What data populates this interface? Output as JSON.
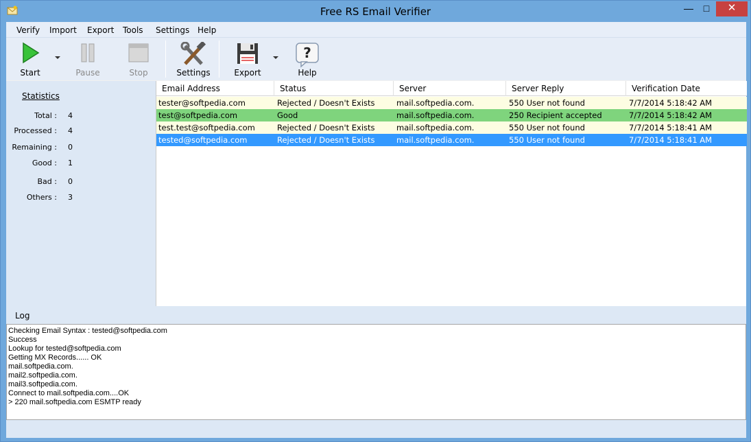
{
  "window": {
    "title": "Free RS Email Verifier",
    "minimize": "—",
    "maximize": "□",
    "close": "✕"
  },
  "menu": [
    "Verify",
    "Import",
    "Export",
    "Tools",
    "Settings",
    "Help"
  ],
  "toolbar": {
    "start": "Start",
    "pause": "Pause",
    "stop": "Stop",
    "settings": "Settings",
    "export": "Export",
    "help": "Help"
  },
  "statistics": {
    "title": "Statistics",
    "items": [
      {
        "label": "Total :",
        "value": "4"
      },
      {
        "label": "Processed :",
        "value": "4"
      },
      {
        "label": "Remaining :",
        "value": "0"
      },
      {
        "label": "Good :",
        "value": "1"
      },
      {
        "label": "Bad :",
        "value": "0"
      },
      {
        "label": "Others :",
        "value": "3"
      }
    ]
  },
  "grid": {
    "columns": [
      "Email Address",
      "Status",
      "Server",
      "Server Reply",
      "Verification Date"
    ],
    "rows": [
      {
        "email": "tester@softpedia.com",
        "status": "Rejected / Doesn't Exists",
        "server": "mail.softpedia.com.",
        "reply": "550 User not found",
        "date": "7/7/2014 5:18:42 AM",
        "state": "rejected"
      },
      {
        "email": "test@softpedia.com",
        "status": "Good",
        "server": "mail.softpedia.com.",
        "reply": "250 Recipient accepted",
        "date": "7/7/2014 5:18:42 AM",
        "state": "good"
      },
      {
        "email": "test.test@softpedia.com",
        "status": "Rejected / Doesn't Exists",
        "server": "mail.softpedia.com.",
        "reply": "550 User not found",
        "date": "7/7/2014 5:18:41 AM",
        "state": "rejected"
      },
      {
        "email": "tested@softpedia.com",
        "status": "Rejected / Doesn't Exists",
        "server": "mail.softpedia.com.",
        "reply": "550 User not found",
        "date": "7/7/2014 5:18:41 AM",
        "state": "selected"
      }
    ]
  },
  "log": {
    "title": "Log",
    "lines": [
      "Checking Email Syntax : tested@softpedia.com",
      "Success",
      "Lookup for tested@softpedia.com",
      "Getting MX Records...... OK",
      "mail.softpedia.com.",
      "mail2.softpedia.com.",
      "mail3.softpedia.com.",
      "Connect to mail.softpedia.com....OK",
      "> 220 mail.softpedia.com ESMTP ready"
    ]
  },
  "colors": {
    "titlebar": "#6fa8dc",
    "good_row": "#7fd47d",
    "rejected_row": "#fdfde2",
    "selected_row": "#3399ff",
    "close_button": "#c74140"
  }
}
